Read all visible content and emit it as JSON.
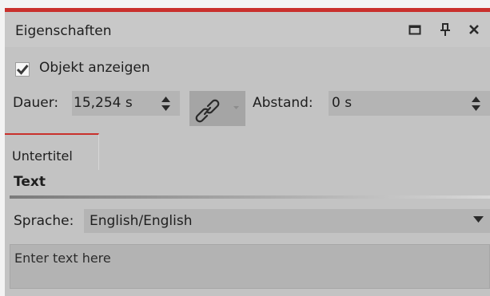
{
  "colors": {
    "accent": "#c9302c",
    "panel_bg": "#c3c3c3",
    "field_bg": "#b4b4b4",
    "button_bg": "#a5a5a5"
  },
  "panel": {
    "title": "Eigenschaften",
    "icons": [
      "maximize-icon",
      "pin-icon",
      "close-icon"
    ]
  },
  "show_object": {
    "checked": true,
    "label": "Objekt anzeigen"
  },
  "duration": {
    "label": "Dauer:",
    "value": "15,254 s"
  },
  "link_button": {
    "icon": "chain-link-icon"
  },
  "spacing": {
    "label": "Abstand:",
    "value": "0 s"
  },
  "tabs": [
    {
      "label": "Untertitel",
      "active": true
    }
  ],
  "section": {
    "title": "Text"
  },
  "language": {
    "label": "Sprache:",
    "value": "English/English"
  },
  "text_input": {
    "value": "Enter text here"
  }
}
